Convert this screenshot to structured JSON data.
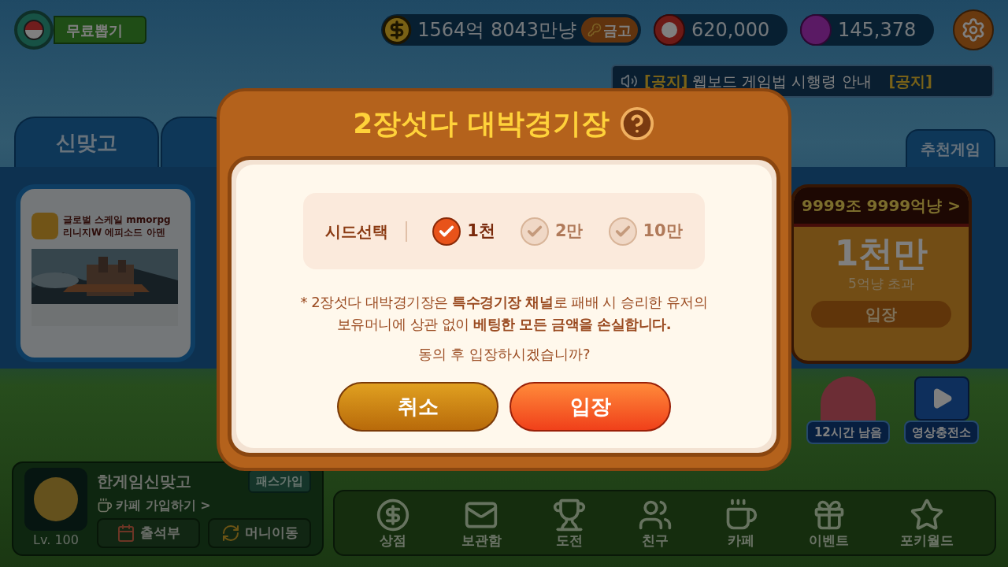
{
  "top_bar": {
    "free_draw": "무료뽑기",
    "money": "1564억 8043만냥",
    "vault": "금고",
    "points": "620,000",
    "gems": "145,378"
  },
  "notices": [
    {
      "tag": "[공지]",
      "text": "웹보드 게임법 시행령 안내"
    },
    {
      "tag": "[공지]"
    }
  ],
  "game_tabs": [
    "신맞고"
  ],
  "side_tab": "추천게임",
  "ad_card": {
    "title_lines": [
      "글로벌 스케일 mmorpg",
      "리니지W 에피소드 아덴"
    ]
  },
  "arena_card": {
    "jackpot": "9999조 9999억냥 >",
    "seed": "1천만",
    "condition": "5억냥 초과",
    "button": "입장"
  },
  "profile": {
    "name": "한게임신맞고",
    "level": "Lv. 100",
    "pass": "패스가입",
    "cafe": "카페 가입하기 >",
    "attendance": "출석부",
    "transfer": "머니이동"
  },
  "rewards": [
    {
      "label": "12시간 남음",
      "kind": "timer"
    },
    {
      "label": "영상충전소",
      "kind": "video"
    }
  ],
  "nav": [
    {
      "label": "상점",
      "kind": "shop"
    },
    {
      "label": "보관함",
      "kind": "storage"
    },
    {
      "label": "도전",
      "kind": "challenge"
    },
    {
      "label": "친구",
      "kind": "friends"
    },
    {
      "label": "카페",
      "kind": "cafe"
    },
    {
      "label": "이벤트",
      "kind": "event"
    },
    {
      "label": "포키월드",
      "kind": "world"
    }
  ],
  "dialog": {
    "title": "2장섯다 대박경기장",
    "seed_label": "시드선택",
    "seeds": [
      {
        "label": "1천",
        "selected": true
      },
      {
        "label": "2만",
        "selected": false
      },
      {
        "label": "10만",
        "selected": false
      }
    ],
    "notice_lines": [
      "* 2장섯다 대박경기장은 **특수경기장 채널**로 패배 시 승리한 유저의",
      "보유머니에 상관 없이 **베팅한 모든 금액을 손실합니다.**"
    ],
    "question": "동의 후 입장하시겠습니까?",
    "cancel": "취소",
    "enter": "입장"
  }
}
